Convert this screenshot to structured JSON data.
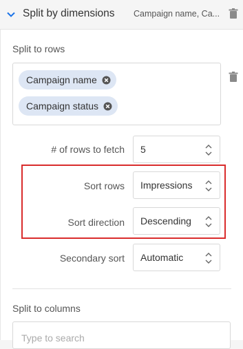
{
  "header": {
    "title": "Split by dimensions",
    "summary": "Campaign name, Ca..."
  },
  "split_to_rows": {
    "label": "Split to rows",
    "chips": [
      "Campaign name",
      "Campaign status"
    ]
  },
  "fields": {
    "rows_to_fetch": {
      "label": "# of rows to fetch",
      "value": "5"
    },
    "sort_rows": {
      "label": "Sort rows",
      "value": "Impressions"
    },
    "sort_direction": {
      "label": "Sort direction",
      "value": "Descending"
    },
    "secondary_sort": {
      "label": "Secondary sort",
      "value": "Automatic"
    }
  },
  "split_to_columns": {
    "label": "Split to columns",
    "search_placeholder": "Type to search"
  },
  "colors": {
    "chip_bg": "#dde6f4",
    "accent_blue": "#1a73e8",
    "highlight_red": "#d92b2b"
  }
}
